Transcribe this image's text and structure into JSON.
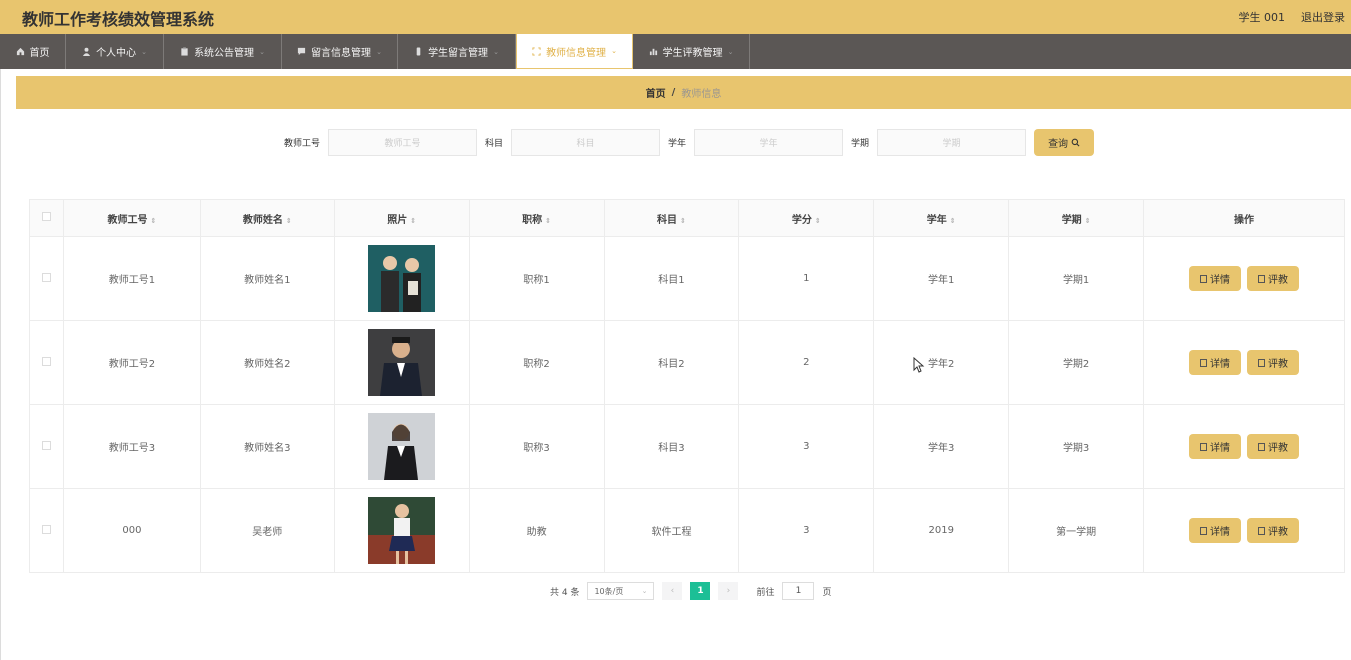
{
  "header": {
    "app_title": "教师工作考核绩效管理系统",
    "user_label": "学生 001",
    "logout_label": "退出登录"
  },
  "nav": {
    "items": [
      {
        "label": "首页",
        "icon": "home-icon",
        "has_menu": false,
        "active": false
      },
      {
        "label": "个人中心",
        "icon": "user-icon",
        "has_menu": true,
        "active": false
      },
      {
        "label": "系统公告管理",
        "icon": "clipboard-icon",
        "has_menu": true,
        "active": false
      },
      {
        "label": "留言信息管理",
        "icon": "message-icon",
        "has_menu": true,
        "active": false
      },
      {
        "label": "学生留言管理",
        "icon": "phone-icon",
        "has_menu": true,
        "active": false
      },
      {
        "label": "教师信息管理",
        "icon": "frame-icon",
        "has_menu": true,
        "active": true
      },
      {
        "label": "学生评教管理",
        "icon": "bar-chart-icon",
        "has_menu": true,
        "active": false
      }
    ]
  },
  "breadcrumb": {
    "home": "首页",
    "separator": "/",
    "current": "教师信息"
  },
  "search": {
    "fields": [
      {
        "label": "教师工号",
        "placeholder": "教师工号"
      },
      {
        "label": "科目",
        "placeholder": "科目"
      },
      {
        "label": "学年",
        "placeholder": "学年"
      },
      {
        "label": "学期",
        "placeholder": "学期"
      }
    ],
    "query_label": "查询"
  },
  "table": {
    "columns": [
      "教师工号",
      "教师姓名",
      "照片",
      "职称",
      "科目",
      "学分",
      "学年",
      "学期",
      "操作"
    ],
    "rows": [
      {
        "id": "教师工号1",
        "name": "教师姓名1",
        "photo": "photo-two-teachers",
        "title": "职称1",
        "subject": "科目1",
        "credit": "1",
        "year": "学年1",
        "term": "学期1"
      },
      {
        "id": "教师工号2",
        "name": "教师姓名2",
        "photo": "photo-male-teacher",
        "title": "职称2",
        "subject": "科目2",
        "credit": "2",
        "year": "学年2",
        "term": "学期2"
      },
      {
        "id": "教师工号3",
        "name": "教师姓名3",
        "photo": "photo-female-teacher",
        "title": "职称3",
        "subject": "科目3",
        "credit": "3",
        "year": "学年3",
        "term": "学期3"
      },
      {
        "id": "000",
        "name": "吴老师",
        "photo": "photo-teacher-blackboard",
        "title": "助教",
        "subject": "软件工程",
        "credit": "3",
        "year": "2019",
        "term": "第一学期"
      }
    ],
    "detail_label": "详情",
    "evaluate_label": "评教"
  },
  "pagination": {
    "total_text": "共 4 条",
    "page_size": "10条/页",
    "current_page": "1",
    "goto_label": "前往",
    "goto_value": "1",
    "page_unit": "页"
  },
  "colors": {
    "accent": "#e8c56e",
    "nav_bg": "#5b5755",
    "pager_active": "#1cbf96"
  }
}
